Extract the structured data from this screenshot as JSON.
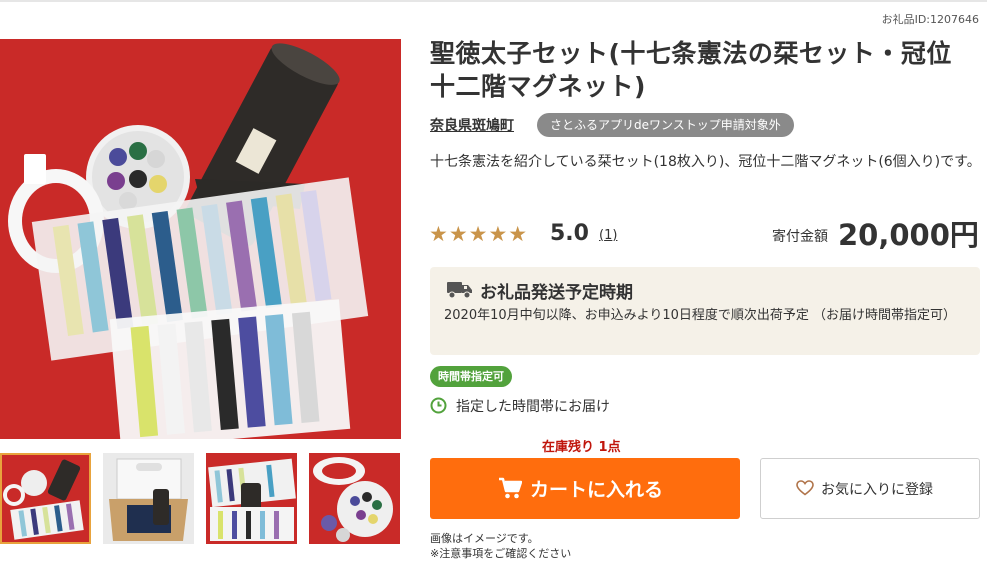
{
  "page": {
    "gift_id": "お礼品ID:1207646",
    "title": "聖徳太子セット(十七条憲法の栞セット・冠位十二階マグネット)",
    "municipality": "奈良県斑鳩町",
    "onestop_badge": "さとふるアプリdeワンストップ申請対象外",
    "description": "十七条憲法を紹介している栞セット(18枚入り)、冠位十二階マグネット(6個入り)です。",
    "rating": {
      "stars": "★★★★★",
      "value": "5.0",
      "count": "1",
      "paren_open": "(",
      "paren_close": ")",
      "score": 5.0,
      "max": 5
    },
    "price_label": "寄付金額",
    "price": "20,000円",
    "shipping": {
      "title": "お礼品発送予定時期",
      "text": "2020年10月中旬以降、お申込みより10日程度で順次出荷予定 （お届け時間帯指定可）",
      "icon": "truck-icon"
    },
    "delivery_tag": "時間帯指定可",
    "delivery_text": "指定した時間帯にお届け",
    "stock": "在庫残り 1点",
    "cart_button": "カートに入れる",
    "favorite_button": "お気に入りに登録",
    "notes": [
      "画像はイメージです。",
      "※注意事項をご確認ください"
    ],
    "colors": {
      "cart": "#ff6d0d",
      "green_tag": "#52a23c",
      "star": "#c9944a",
      "stock": "#c0150b",
      "image_bg": "#c92a28"
    }
  }
}
